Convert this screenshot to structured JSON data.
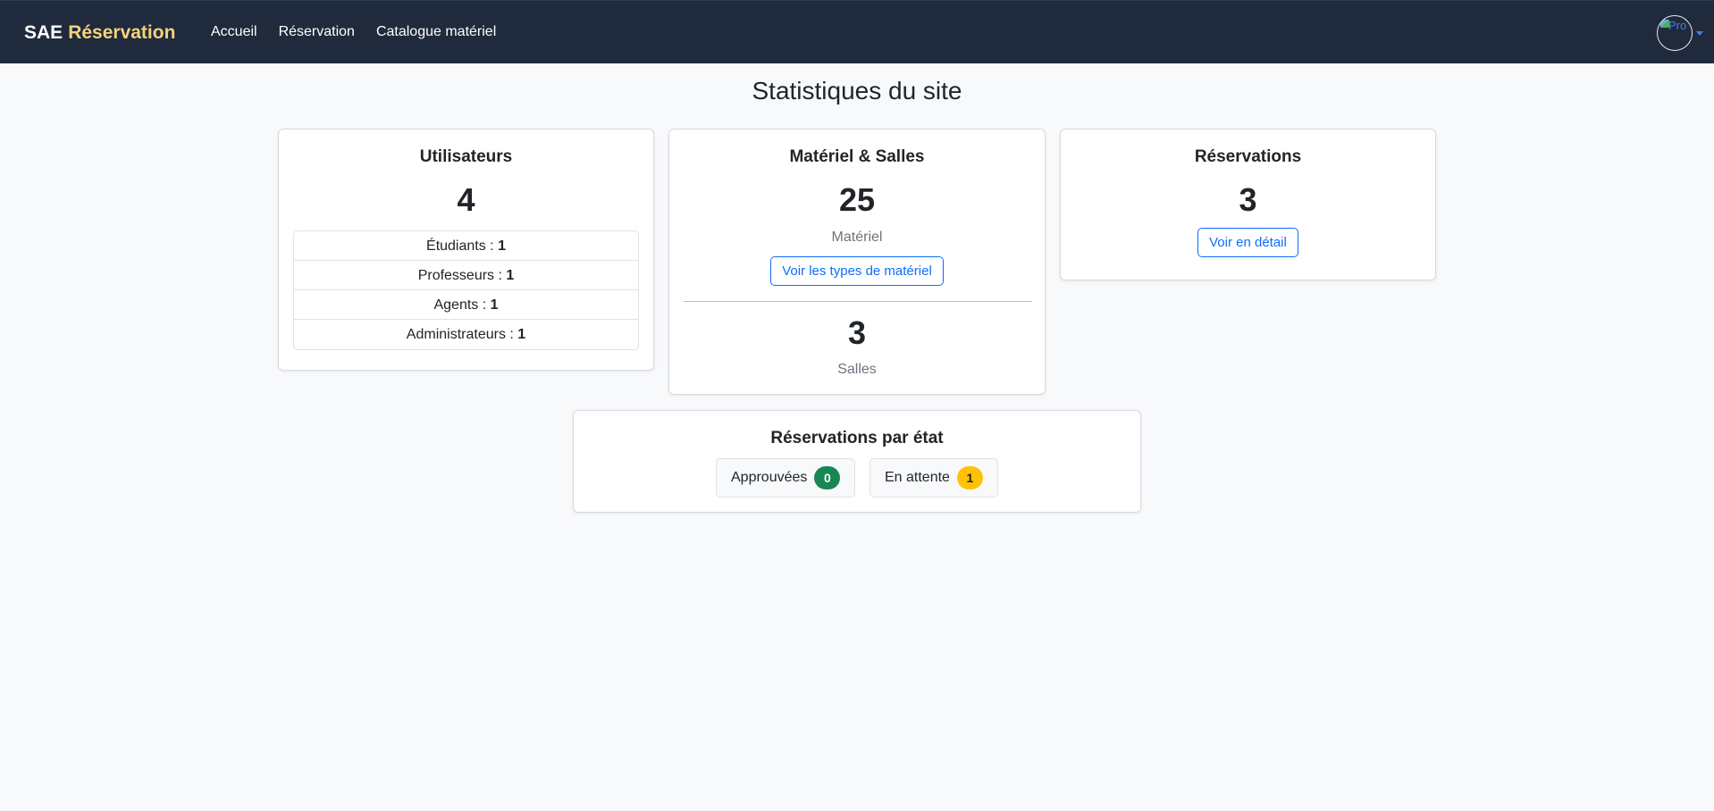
{
  "navbar": {
    "brand_prefix": "SAE",
    "brand_suffix": "Réservation",
    "links": [
      "Accueil",
      "Réservation",
      "Catalogue matériel"
    ],
    "avatar_alt": "Pro"
  },
  "page": {
    "title": "Statistiques du site"
  },
  "users_card": {
    "title": "Utilisateurs",
    "total": "4",
    "rows": [
      {
        "label": "Étudiants : ",
        "value": "1"
      },
      {
        "label": "Professeurs : ",
        "value": "1"
      },
      {
        "label": "Agents : ",
        "value": "1"
      },
      {
        "label": "Administrateurs : ",
        "value": "1"
      }
    ]
  },
  "materials_card": {
    "title": "Matériel & Salles",
    "material_count": "25",
    "material_label": "Matériel",
    "types_button": "Voir les types de matériel",
    "rooms_count": "3",
    "rooms_label": "Salles"
  },
  "reservations_card": {
    "title": "Réservations",
    "count": "3",
    "detail_button": "Voir en détail"
  },
  "state_card": {
    "title": "Réservations par état",
    "approved_label": "Approuvées",
    "approved_count": "0",
    "pending_label": "En attente",
    "pending_count": "1"
  },
  "colors": {
    "navbar_bg": "#1f2a3c",
    "brand_accent": "#f5d27a",
    "primary": "#0d6efd",
    "success": "#198754",
    "warning": "#ffc107"
  }
}
